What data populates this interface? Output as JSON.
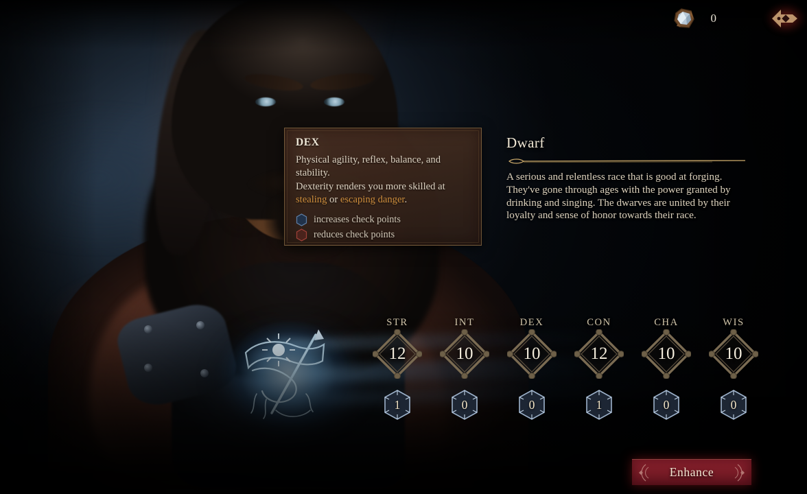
{
  "colors": {
    "accent_gold": "#d08f3e",
    "text_cream": "#ded3c2",
    "tooltip_bg": "#46321f",
    "button_red": "#7b1c27",
    "hex_blue": "#8fa8c4",
    "hex_red": "#a04038",
    "sigil_blue": "#9fd4f2"
  },
  "topbar": {
    "currency_icon": "gem-icon",
    "currency_value": "0",
    "emblem_icon": "arrow-emblem-icon"
  },
  "tooltip": {
    "title": "DEX",
    "line1": "Physical agility, reflex, balance, and stability.",
    "line2_prefix": "Dexterity renders you more skilled at ",
    "highlight1": "stealing",
    "conjunction": " or ",
    "highlight2": "escaping danger",
    "line2_suffix": ".",
    "legend": [
      {
        "icon": "hexagon-blue-icon",
        "label": "increases check points"
      },
      {
        "icon": "hexagon-red-icon",
        "label": "reduces check points"
      }
    ]
  },
  "race": {
    "title": "Dwarf",
    "description": "A serious and relentless race that is good at forging. They've gone through ages with the power granted by drinking and singing. The dwarves are united by their loyalty and sense of honor towards their race."
  },
  "stats": {
    "labels": [
      "STR",
      "INT",
      "DEX",
      "CON",
      "CHA",
      "WIS"
    ],
    "values": [
      "12",
      "10",
      "10",
      "12",
      "10",
      "10"
    ],
    "modifiers": [
      "1",
      "0",
      "0",
      "1",
      "0",
      "0"
    ]
  },
  "actions": {
    "enhance_label": "Enhance"
  }
}
